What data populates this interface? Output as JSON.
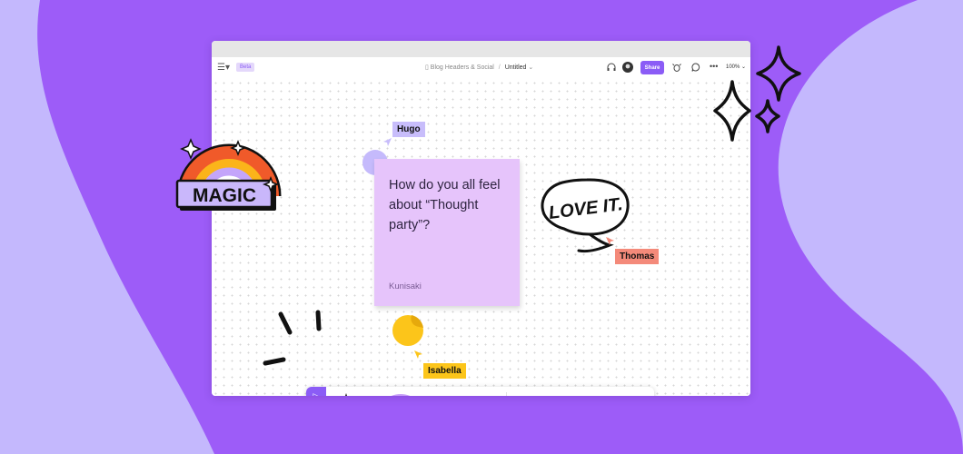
{
  "colors": {
    "bg_purple": "#9d5cf8",
    "bg_lavender": "#c4b8fd",
    "accent": "#8b5cf6",
    "sticky": "#e6c4fb",
    "hugo": "#c8bdfb",
    "thomas": "#f48a7a",
    "isabella": "#fcc51a"
  },
  "toolbar": {
    "menu_icon": "figjam-logo-icon",
    "beta_badge": "Beta",
    "project": "Blog Headers & Social",
    "separator": "/",
    "file_name": "Untitled",
    "share_label": "Share",
    "zoom": "100%"
  },
  "canvas": {
    "sticky_note": {
      "text": "How do you all feel about “Thought party”?",
      "author": "Kunisaki"
    },
    "cursors": [
      {
        "name": "Hugo"
      },
      {
        "name": "Thomas"
      },
      {
        "name": "Isabella"
      }
    ],
    "speech_bubble_text": "LOVE IT."
  },
  "sticker": {
    "text": "MAGIC"
  },
  "dock": {
    "select_icon": "pointer-icon",
    "hand_icon": "hand-icon",
    "tools": [
      "text-tool-icon",
      "connector-icon",
      "component-icon",
      "stamp-icon",
      "image-icon"
    ]
  },
  "help_label": "?"
}
